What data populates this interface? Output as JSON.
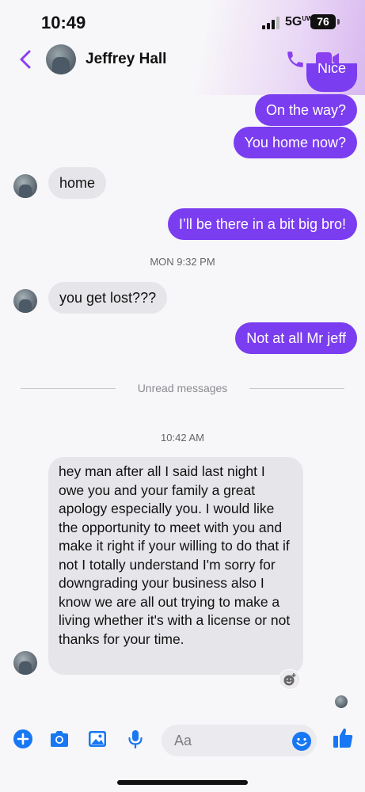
{
  "status_bar": {
    "time": "10:49",
    "network": "5G",
    "network_badge": "UW",
    "battery": "76"
  },
  "header": {
    "contact_name": "Jeffrey Hall"
  },
  "messages": {
    "partial_top": "Nice",
    "on_the_way": "On the way?",
    "you_home": "You home now?",
    "home": "home",
    "be_there": "I’ll be there in a bit big bro!",
    "mon_time": "MON 9:32 PM",
    "get_lost": "you get lost???",
    "not_at_all": "Not at all Mr jeff",
    "unread_label": "Unread messages",
    "time_1042": "10:42 AM",
    "long_message": "hey man after all I said last night I owe you and your family a great apology especially you. I would like the opportunity to meet with you and make it right if your willing to do that if not I totally understand I'm sorry for downgrading your business also I know we are all out trying to make a living whether it's with a license or not thanks for your time."
  },
  "composer": {
    "placeholder": "Aa"
  },
  "icons": {
    "back": "chevron-left-icon",
    "call": "phone-icon",
    "video": "video-camera-icon",
    "plus": "plus-circle-icon",
    "camera": "camera-icon",
    "gallery": "image-icon",
    "mic": "microphone-icon",
    "emoji": "emoji-icon",
    "like": "thumbs-up-icon",
    "react": "add-reaction-icon"
  },
  "colors": {
    "accent_purple": "#8a3ff0",
    "outgoing_bubble": "#7b3df0",
    "incoming_bubble": "#e6e5e9",
    "composer_blue": "#1877f2"
  }
}
